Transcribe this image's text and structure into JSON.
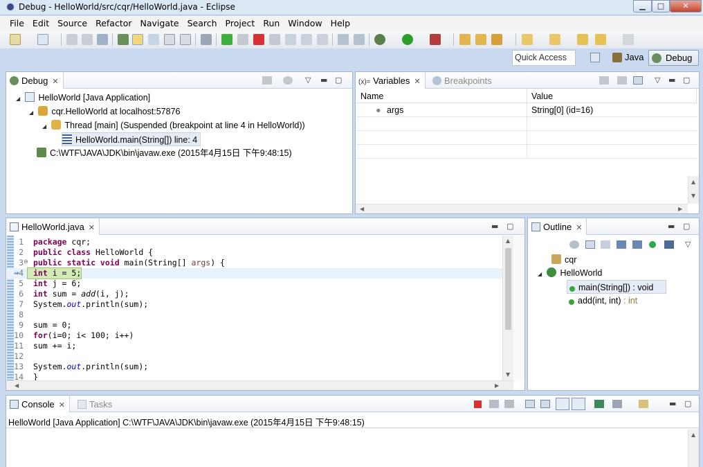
{
  "window": {
    "title": "Debug - HelloWorld/src/cqr/HelloWorld.java - Eclipse",
    "minimize": "▁",
    "maximize": "□",
    "close": "✕"
  },
  "menu": [
    "File",
    "Edit",
    "Source",
    "Refactor",
    "Navigate",
    "Search",
    "Project",
    "Run",
    "Window",
    "Help"
  ],
  "quick_access": {
    "placeholder": "Quick Access"
  },
  "perspectives": {
    "java": "Java",
    "debug": "Debug"
  },
  "debug_view": {
    "tab": "Debug",
    "tree": [
      {
        "label": "HelloWorld [Java Application]"
      },
      {
        "label": "cqr.HelloWorld at localhost:57876"
      },
      {
        "label": "Thread [main] (Suspended (breakpoint at line 4 in HelloWorld))"
      },
      {
        "label": "HelloWorld.main(String[]) line: 4"
      },
      {
        "label": "C:\\WTF\\JAVA\\JDK\\bin\\javaw.exe (2015年4月15日 下午9:48:15)"
      }
    ]
  },
  "variables_view": {
    "tab": "Variables",
    "tab2": "Breakpoints",
    "columns": [
      "Name",
      "Value"
    ],
    "rows": [
      {
        "name": "args",
        "value": "String[0]  (id=16)"
      }
    ]
  },
  "editor": {
    "tab": "HelloWorld.java",
    "lines": [
      {
        "n": "1",
        "t": "package cqr;"
      },
      {
        "n": "2",
        "t": "public class HelloWorld {"
      },
      {
        "n": "3",
        "t": "public static void main(String[] args) {"
      },
      {
        "n": "4",
        "t": "int i = 5;"
      },
      {
        "n": "5",
        "t": "int j = 6;"
      },
      {
        "n": "6",
        "t": "int sum = add(i, j);"
      },
      {
        "n": "7",
        "t": "System.out.println(sum);"
      },
      {
        "n": "8",
        "t": ""
      },
      {
        "n": "9",
        "t": "sum = 0;"
      },
      {
        "n": "10",
        "t": "for(i=0; i< 100; i++)"
      },
      {
        "n": "11",
        "t": "sum += i;"
      },
      {
        "n": "12",
        "t": ""
      },
      {
        "n": "13",
        "t": "System.out.println(sum);"
      },
      {
        "n": "14",
        "t": "}"
      }
    ]
  },
  "outline_view": {
    "tab": "Outline",
    "items": [
      {
        "label": "cqr"
      },
      {
        "label": "HelloWorld"
      },
      {
        "label": "main(String[]) : void"
      },
      {
        "label": "add(int, int)",
        "type": " : int"
      }
    ]
  },
  "console_view": {
    "tab": "Console",
    "tab2": "Tasks",
    "line": "HelloWorld [Java Application] C:\\WTF\\JAVA\\JDK\\bin\\javaw.exe (2015年4月15日 下午9:48:15)"
  },
  "colors": {
    "keyword": "#7f0055",
    "field": "#0000c0",
    "accent": "#3d6fb6"
  }
}
